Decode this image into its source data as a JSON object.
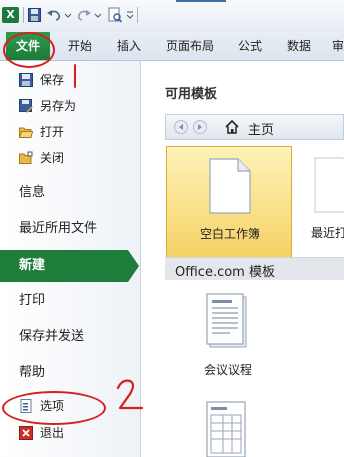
{
  "quick_access": {
    "app_icon": "excel-icon",
    "logo_letter": "X",
    "icons": [
      "save-icon",
      "undo-icon",
      "redo-icon",
      "print-preview-icon",
      "customize-icon"
    ]
  },
  "tabs": [
    {
      "label": "文件",
      "active": true
    },
    {
      "label": "开始"
    },
    {
      "label": "插入"
    },
    {
      "label": "页面布局"
    },
    {
      "label": "公式"
    },
    {
      "label": "数据"
    },
    {
      "label": "审"
    }
  ],
  "nav": {
    "save": "保存",
    "save_as": "另存为",
    "open": "打开",
    "close": "关闭",
    "info": "信息",
    "recent": "最近所用文件",
    "new": "新建",
    "print": "打印",
    "save_send": "保存并发送",
    "help": "帮助",
    "options": "选项",
    "exit": "退出"
  },
  "main": {
    "section_title": "可用模板",
    "breadcrumb_home": "主页",
    "tiles": {
      "blank": "空白工作簿",
      "recent": "最近打"
    },
    "office_section": "Office.com 模板",
    "agenda": "会议议程"
  },
  "annotations": {
    "mark_1": "1",
    "mark_2": "2"
  },
  "colors": {
    "file_tab": "#1f7d3b",
    "highlight_tile": "#f5d265",
    "annotation": "#d62020"
  }
}
